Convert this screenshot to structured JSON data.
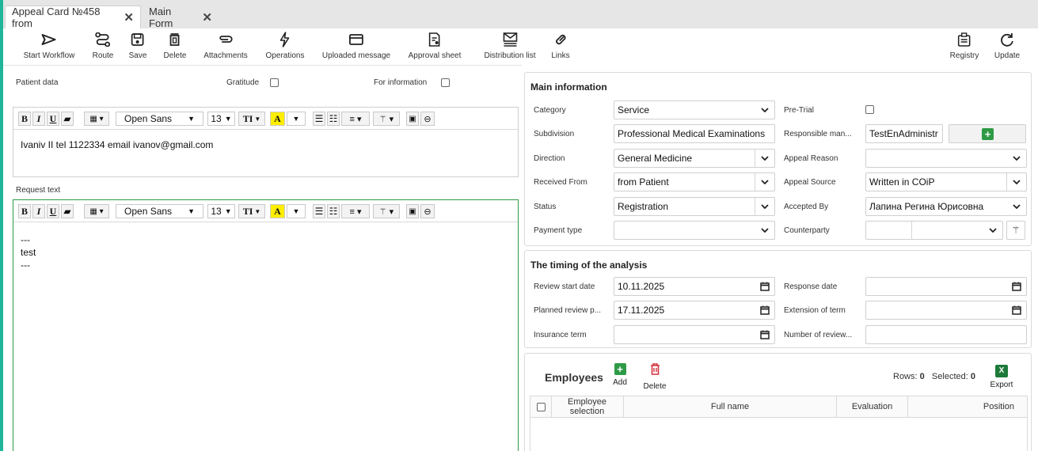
{
  "tabs": [
    {
      "label": "Appeal Card №458 from"
    },
    {
      "label": "Main Form"
    }
  ],
  "toolbar": {
    "start_workflow": "Start Workflow",
    "route": "Route",
    "save": "Save",
    "delete": "Delete",
    "attachments": "Attachments",
    "operations": "Operations",
    "uploaded_message": "Uploaded message",
    "approval_sheet": "Approval sheet",
    "distribution_list": "Distribution list",
    "links": "Links",
    "registry": "Registry",
    "update": "Update"
  },
  "left": {
    "patient_data_label": "Patient data",
    "gratitude_label": "Gratitude",
    "for_information_label": "For information",
    "request_text_label": "Request text",
    "patient_text": "Ivaniv II tel 1122334 email ivanov@gmail.com",
    "request_lines": [
      "---",
      "test",
      "---"
    ]
  },
  "editor_toolbar": {
    "font": "Open Sans",
    "size": "13",
    "bold": "B",
    "italic": "I",
    "underline": "U",
    "color_letter": "A",
    "size_glyph": "TI"
  },
  "main_info": {
    "title": "Main information",
    "category_label": "Category",
    "category_value": "Service",
    "subdivision_label": "Subdivision",
    "subdivision_value": "Professional Medical Examinations",
    "direction_label": "Direction",
    "direction_value": "General Medicine",
    "received_from_label": "Received From",
    "received_from_value": "from Patient",
    "status_label": "Status",
    "status_value": "Registration",
    "payment_type_label": "Payment type",
    "payment_type_value": "",
    "pre_trial_label": "Pre-Trial",
    "responsible_label": "Responsible man...",
    "responsible_value": "TestEnAdministr",
    "appeal_reason_label": "Appeal Reason",
    "appeal_reason_value": "",
    "appeal_source_label": "Appeal Source",
    "appeal_source_value": "Written in COiP",
    "accepted_by_label": "Accepted By",
    "accepted_by_value": "Лапина Регина Юрисовна",
    "counterparty_label": "Counterparty"
  },
  "timing": {
    "title": "The timing of the analysis",
    "review_start_label": "Review start date",
    "review_start_value": "10.11.2025",
    "planned_review_label": "Planned review p...",
    "planned_review_value": "17.11.2025",
    "insurance_term_label": "Insurance term",
    "insurance_term_value": "",
    "response_date_label": "Response date",
    "response_date_value": "",
    "extension_label": "Extension of term",
    "extension_value": "",
    "number_review_label": "Number of review...",
    "number_review_value": ""
  },
  "employees": {
    "title": "Employees",
    "add_label": "Add",
    "delete_label": "Delete",
    "rows_label": "Rows:",
    "rows_value": "0",
    "selected_label": "Selected:",
    "selected_value": "0",
    "export_label": "Export",
    "columns": [
      "Employee selection",
      "Full name",
      "Evaluation",
      "Position"
    ]
  },
  "colors": {
    "accent": "#1fb59a",
    "add_green": "#2e9a46",
    "delete_red": "#d2323e",
    "editor_active_border": "#2e9a46",
    "highlight_yellow": "#ffee00"
  }
}
